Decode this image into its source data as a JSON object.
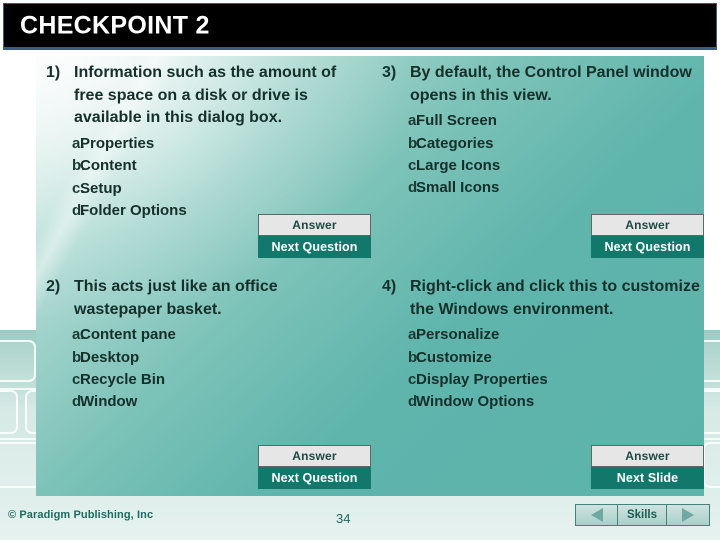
{
  "slide": {
    "title": "CHECKPOINT 2",
    "page_number": "34",
    "copyright": "© Paradigm Publishing, Inc"
  },
  "questions": [
    {
      "number": "1)",
      "stem": "Information such as the amount of free space on a disk or drive is available in this dialog box.",
      "choices": [
        {
          "letter": "a.",
          "text": "Properties"
        },
        {
          "letter": "b.",
          "text": "Content"
        },
        {
          "letter": "c.",
          "text": "Setup"
        },
        {
          "letter": "d.",
          "text": "Folder Options"
        }
      ],
      "answer_label": "Answer",
      "next_label": "Next Question"
    },
    {
      "number": "2)",
      "stem": "This acts just like an office wastepaper basket.",
      "choices": [
        {
          "letter": "a.",
          "text": "Content pane"
        },
        {
          "letter": "b.",
          "text": "Desktop"
        },
        {
          "letter": "c.",
          "text": "Recycle Bin"
        },
        {
          "letter": "d.",
          "text": "Window"
        }
      ],
      "answer_label": "Answer",
      "next_label": "Next Question"
    },
    {
      "number": "3)",
      "stem": "By default, the Control Panel window opens in this view.",
      "choices": [
        {
          "letter": "a.",
          "text": "Full Screen"
        },
        {
          "letter": "b.",
          "text": "Categories"
        },
        {
          "letter": "c.",
          "text": "Large Icons"
        },
        {
          "letter": "d.",
          "text": "Small Icons"
        }
      ],
      "answer_label": "Answer",
      "next_label": "Next Question"
    },
    {
      "number": "4)",
      "stem": "Right-click and click this to customize the Windows environment.",
      "choices": [
        {
          "letter": "a.",
          "text": "Personalize"
        },
        {
          "letter": "b.",
          "text": "Customize"
        },
        {
          "letter": "c.",
          "text": "Display Properties"
        },
        {
          "letter": "d.",
          "text": "Window Options"
        }
      ],
      "answer_label": "Answer",
      "next_label": "Next Slide"
    }
  ],
  "navbar": {
    "previous_icon": "triangle-left-icon",
    "label": "Skills",
    "next_icon": "triangle-right-icon"
  },
  "colors": {
    "title_bar_background": "#000000",
    "title_bar_border": "#3c5a85",
    "panel_teal": "#5fb5ac",
    "panel_highlight": "#e4f1ef",
    "next_button_background": "#11786b",
    "answer_button_background": "#e6e6e6",
    "text_dark": "#152f2a",
    "footer_text": "#1d6a5e"
  }
}
